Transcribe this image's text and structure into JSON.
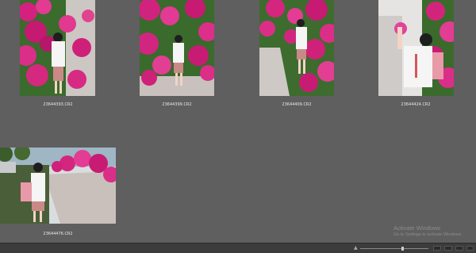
{
  "thumbnails": [
    {
      "filename": "23644393.CR2"
    },
    {
      "filename": "23644399.CR2"
    },
    {
      "filename": "23644409.CR2"
    },
    {
      "filename": "23644424.CR2"
    },
    {
      "filename": "23644476.CR2"
    }
  ],
  "watermark": {
    "title": "Activate Windows",
    "subtitle": "Go to Settings to activate Windows."
  },
  "statusbar": {
    "zoom_slider": 0.62,
    "zoom_icon": "mountain-small-icon"
  },
  "colors": {
    "background": "#5f5f5f",
    "flowers": "#d81e7d",
    "foliage": "#3f6e2e",
    "statusbar": "#3c3c3c"
  }
}
